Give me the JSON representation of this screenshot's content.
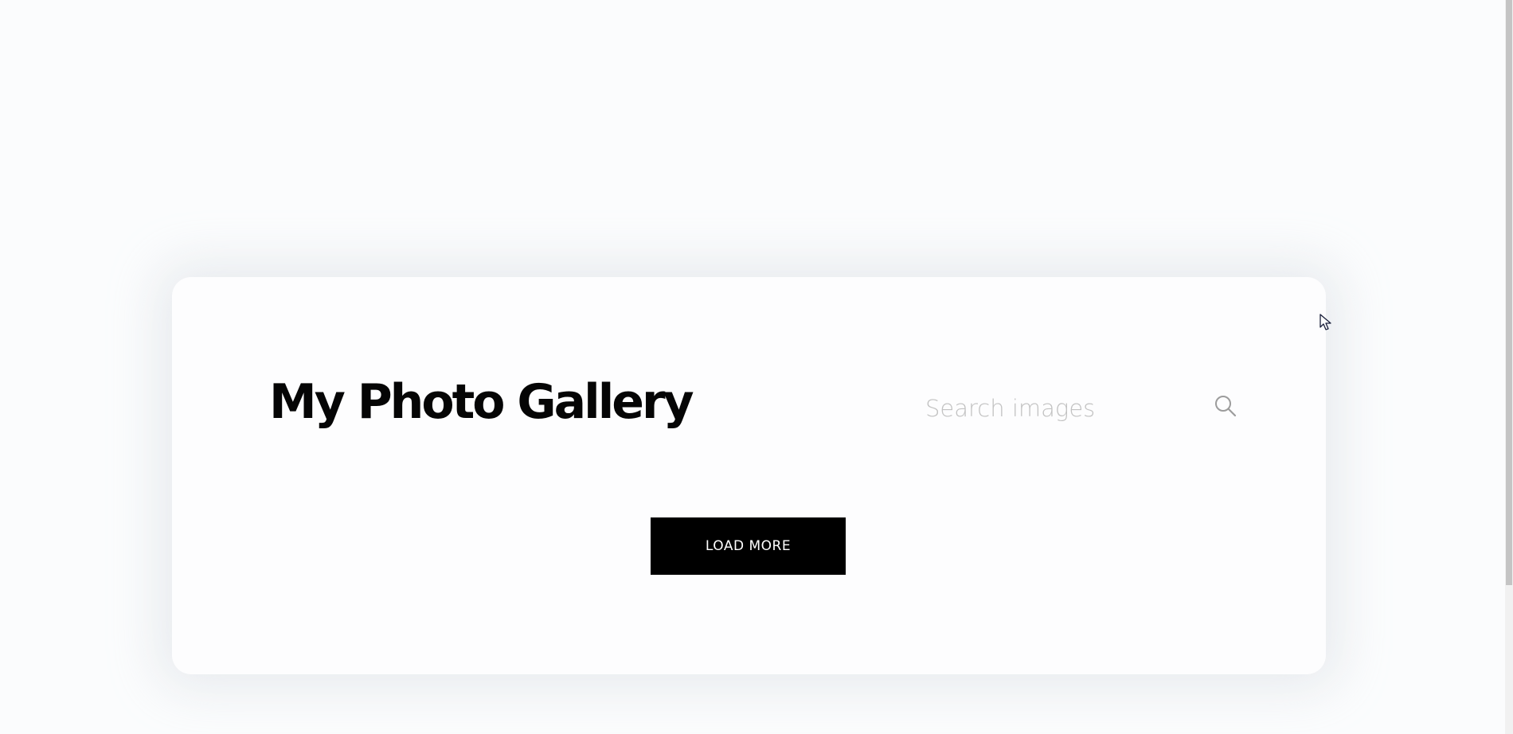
{
  "gallery": {
    "title": "My Photo Gallery",
    "search": {
      "placeholder": "Search images",
      "value": "",
      "icon": "search-icon"
    },
    "load_more_label": "LOAD MORE"
  },
  "colors": {
    "page_background": "#fbfcfd",
    "card_background": "#fdfdfe",
    "title_text": "#050505",
    "button_background": "#000000",
    "button_text": "#ffffff",
    "placeholder_text": "#c2c2c2"
  }
}
